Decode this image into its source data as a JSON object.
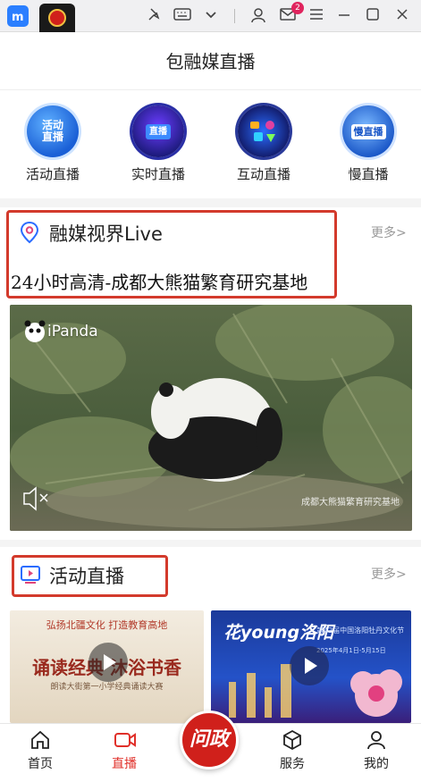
{
  "window": {
    "badge_count": "2"
  },
  "header": {
    "title": "包融媒直播"
  },
  "categories": [
    {
      "icon_text": "活动\n直播",
      "label": "活动直播",
      "icon": "activity-live-icon"
    },
    {
      "icon_text": "直播",
      "label": "实时直播",
      "icon": "realtime-live-icon"
    },
    {
      "icon_text": "",
      "label": "互动直播",
      "icon": "interactive-live-icon"
    },
    {
      "icon_text": "慢直播",
      "label": "慢直播",
      "icon": "slow-live-icon"
    }
  ],
  "section_live": {
    "title": "融媒视界Live",
    "more": "更多>",
    "stream_title": "24小时高清-成都大熊猫繁育研究基地",
    "watermark": "iPanda",
    "caption_overlay": "成都大熊猫繁育研究基地"
  },
  "section_activity": {
    "title": "活动直播",
    "more": "更多>",
    "cards": [
      {
        "top_line": "弘扬北疆文化  打造教育高地",
        "main_text": "诵读经典 沐浴书香",
        "sub_text": "朗读大街第一小学经典诵读大赛"
      },
      {
        "top_line": "花young洛阳",
        "main_text": "第42届中国洛阳牡丹文化节",
        "sub_text": "2025年4月1日-5月15日"
      }
    ]
  },
  "bottom_nav": {
    "items": [
      {
        "label": "首页",
        "icon": "home-icon"
      },
      {
        "label": "直播",
        "icon": "live-video-icon"
      },
      {
        "label": "服务",
        "icon": "service-box-icon"
      },
      {
        "label": "我的",
        "icon": "profile-icon"
      }
    ],
    "center_label": "问政"
  },
  "colors": {
    "accent_red": "#d33a2c",
    "nav_active": "#e0302a"
  }
}
